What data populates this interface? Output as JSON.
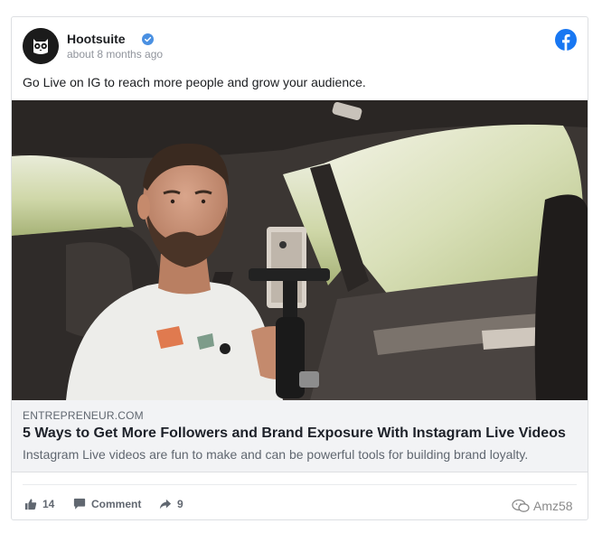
{
  "post": {
    "page_name": "Hootsuite",
    "time": "about 8 months ago",
    "text": "Go Live on IG to reach more people and grow your audience."
  },
  "link": {
    "domain": "ENTREPRENEUR.COM",
    "title": "5 Ways to Get More Followers and Brand Exposure With Instagram Live Videos",
    "description": "Instagram Live videos are fun to make and can be powerful tools for building brand loyalty."
  },
  "actions": {
    "likes": "14",
    "comment_label": "Comment",
    "shares": "9"
  },
  "watermark": "Amz58",
  "colors": {
    "facebook_blue": "#1877f2",
    "verified_blue": "#4a90e2"
  },
  "icons": [
    "owl-logo-icon",
    "verified-badge-icon",
    "facebook-logo-icon",
    "like-icon",
    "comment-icon",
    "share-icon",
    "wechat-icon"
  ]
}
